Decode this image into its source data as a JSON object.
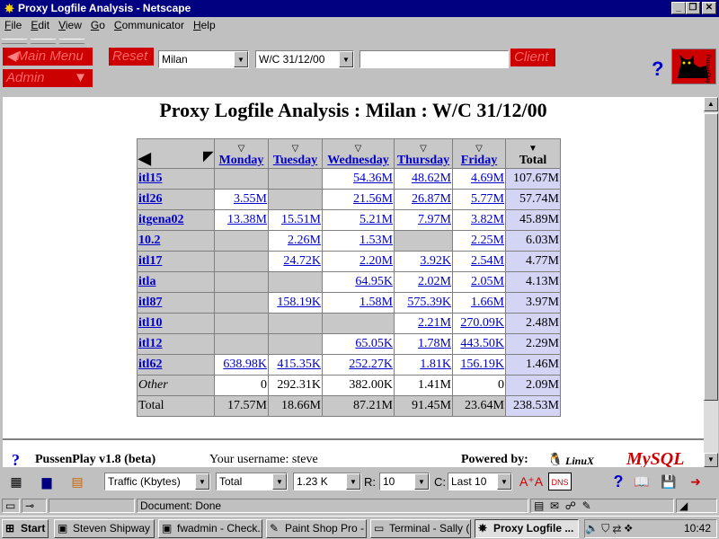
{
  "window": {
    "title": "Proxy Logfile Analysis - Netscape"
  },
  "menu": [
    "File",
    "Edit",
    "View",
    "Go",
    "Communicator",
    "Help"
  ],
  "nav": {
    "main_menu": "Main Menu",
    "reset": "Reset",
    "admin": "Admin",
    "site_select": "Milan",
    "week_select": "W/C 31/12/00",
    "client_value": "",
    "client_button": "Client",
    "help": "?",
    "logo_text": "PussenPlay"
  },
  "report": {
    "title": "Proxy Logfile Analysis : Milan : W/C 31/12/00",
    "columns": [
      "Monday",
      "Tuesday",
      "Wednesday",
      "Thursday",
      "Friday",
      "Total"
    ],
    "rows": [
      {
        "name": "itl15",
        "values": [
          "",
          "",
          "54.36M",
          "48.62M",
          "4.69M",
          "107.67M"
        ]
      },
      {
        "name": "itl26",
        "values": [
          "3.55M",
          "",
          "21.56M",
          "26.87M",
          "5.77M",
          "57.74M"
        ]
      },
      {
        "name": "itgena02",
        "values": [
          "13.38M",
          "15.51M",
          "5.21M",
          "7.97M",
          "3.82M",
          "45.89M"
        ]
      },
      {
        "name": "10.2",
        "values": [
          "",
          "2.26M",
          "1.53M",
          "",
          "2.25M",
          "6.03M"
        ]
      },
      {
        "name": "itl17",
        "values": [
          "",
          "24.72K",
          "2.20M",
          "3.92K",
          "2.54M",
          "4.77M"
        ]
      },
      {
        "name": "itla",
        "values": [
          "",
          "",
          "64.95K",
          "2.02M",
          "2.05M",
          "4.13M"
        ]
      },
      {
        "name": "itl87",
        "values": [
          "",
          "158.19K",
          "1.58M",
          "575.39K",
          "1.66M",
          "3.97M"
        ]
      },
      {
        "name": "itl10",
        "values": [
          "",
          "",
          "",
          "2.21M",
          "270.09K",
          "2.48M"
        ]
      },
      {
        "name": "itl12",
        "values": [
          "",
          "",
          "65.05K",
          "1.78M",
          "443.50K",
          "2.29M"
        ]
      },
      {
        "name": "itl62",
        "values": [
          "638.98K",
          "415.35K",
          "252.27K",
          "1.81K",
          "156.19K",
          "1.46M"
        ]
      }
    ],
    "other": {
      "label": "Other",
      "values": [
        "0",
        "292.31K",
        "382.00K",
        "1.41M",
        "0",
        "2.09M"
      ]
    },
    "total": {
      "label": "Total",
      "values": [
        "17.57M",
        "18.66M",
        "87.21M",
        "91.45M",
        "23.64M",
        "238.53M"
      ]
    }
  },
  "footer": {
    "version": "PussenPlay v1.8 (beta)",
    "username_label": "Your username: steve",
    "powered_by": "Powered by:",
    "linux": "LinuX",
    "mysql": "MySQL"
  },
  "toolbar": {
    "metric": "Traffic (Kbytes)",
    "aggregate": "Total",
    "threshold": "1.23 K",
    "r_label": "R:",
    "r_value": "10",
    "c_label": "C:",
    "c_value": "Last 10",
    "dns": "DNS",
    "help": "?"
  },
  "status": {
    "text": "Document: Done"
  },
  "taskbar": {
    "start": "Start",
    "tasks": [
      "Steven Shipway ...",
      "fwadmin - Check...",
      "Paint Shop Pro - ...",
      "Terminal - Sally (...",
      "Proxy Logfile ..."
    ],
    "clock": "10:42"
  },
  "colors": {
    "title_bar": "#000080",
    "link": "#0000cc",
    "red_button": "#cc0000",
    "total_column": "#d4d4f4"
  }
}
